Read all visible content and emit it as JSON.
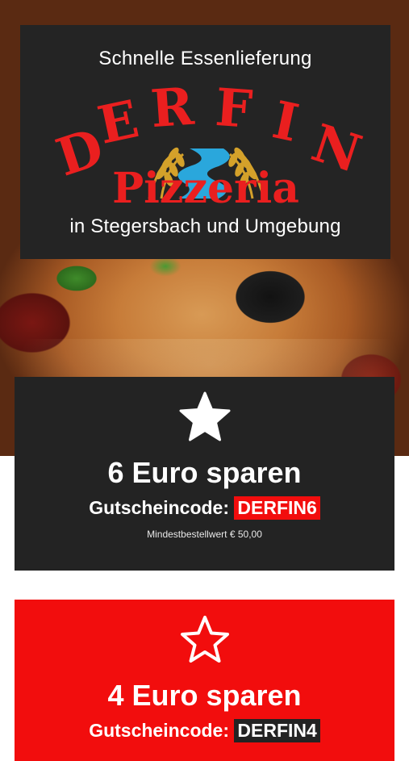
{
  "hero": {
    "tagline_top": "Schnelle Essenlieferung",
    "tagline_bottom": "in Stegersbach und Umgebung",
    "logo": {
      "letters": [
        "D",
        "E",
        "R",
        "F",
        "I",
        "N"
      ],
      "subtitle": "Pizzeria",
      "colors": {
        "text": "#ea1f1f",
        "river": "#2aa7dc",
        "wheat": "#d4a12a"
      }
    }
  },
  "coupons": [
    {
      "icon": "star-filled-icon",
      "amount": "6 Euro sparen",
      "code_label": "Gutscheincode:",
      "code": "DERFIN6",
      "minimum": "Mindestbestellwert € 50,00",
      "background": "#232323",
      "accent": "#f20d0d"
    },
    {
      "icon": "star-outline-icon",
      "amount": "4 Euro sparen",
      "code_label": "Gutscheincode:",
      "code": "DERFIN4",
      "background": "#f20d0d",
      "accent": "#232323"
    }
  ]
}
